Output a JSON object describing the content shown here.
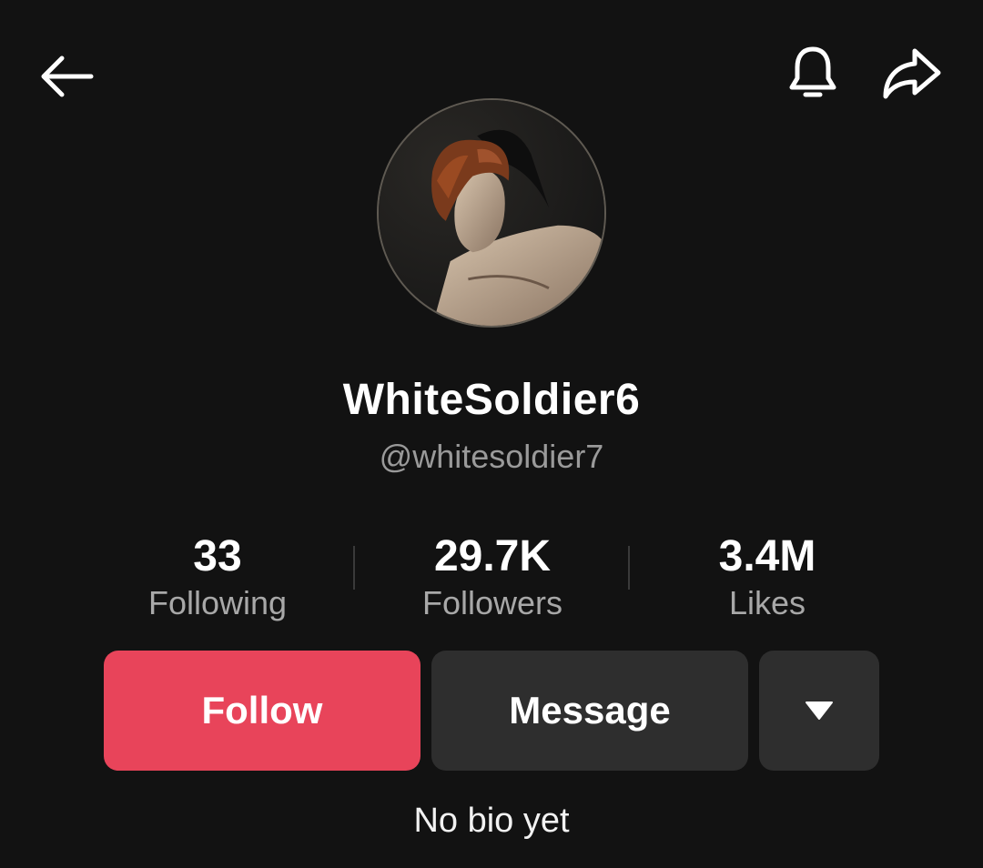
{
  "header": {
    "back_icon": "arrow-left-icon",
    "notification_icon": "bell-icon",
    "share_icon": "share-arrow-icon"
  },
  "profile": {
    "avatar_icon": "profile-photo",
    "display_name": "WhiteSoldier6",
    "username": "@whitesoldier7"
  },
  "stats": [
    {
      "value": "33",
      "label": "Following"
    },
    {
      "value": "29.7K",
      "label": "Followers"
    },
    {
      "value": "3.4M",
      "label": "Likes"
    }
  ],
  "actions": {
    "follow_label": "Follow",
    "message_label": "Message",
    "more_icon": "caret-down-icon"
  },
  "bio": "No bio yet",
  "colors": {
    "background": "#121212",
    "follow_button": "#e8445a",
    "secondary_button": "#2e2e2e",
    "muted_text": "#9a9a9a"
  }
}
